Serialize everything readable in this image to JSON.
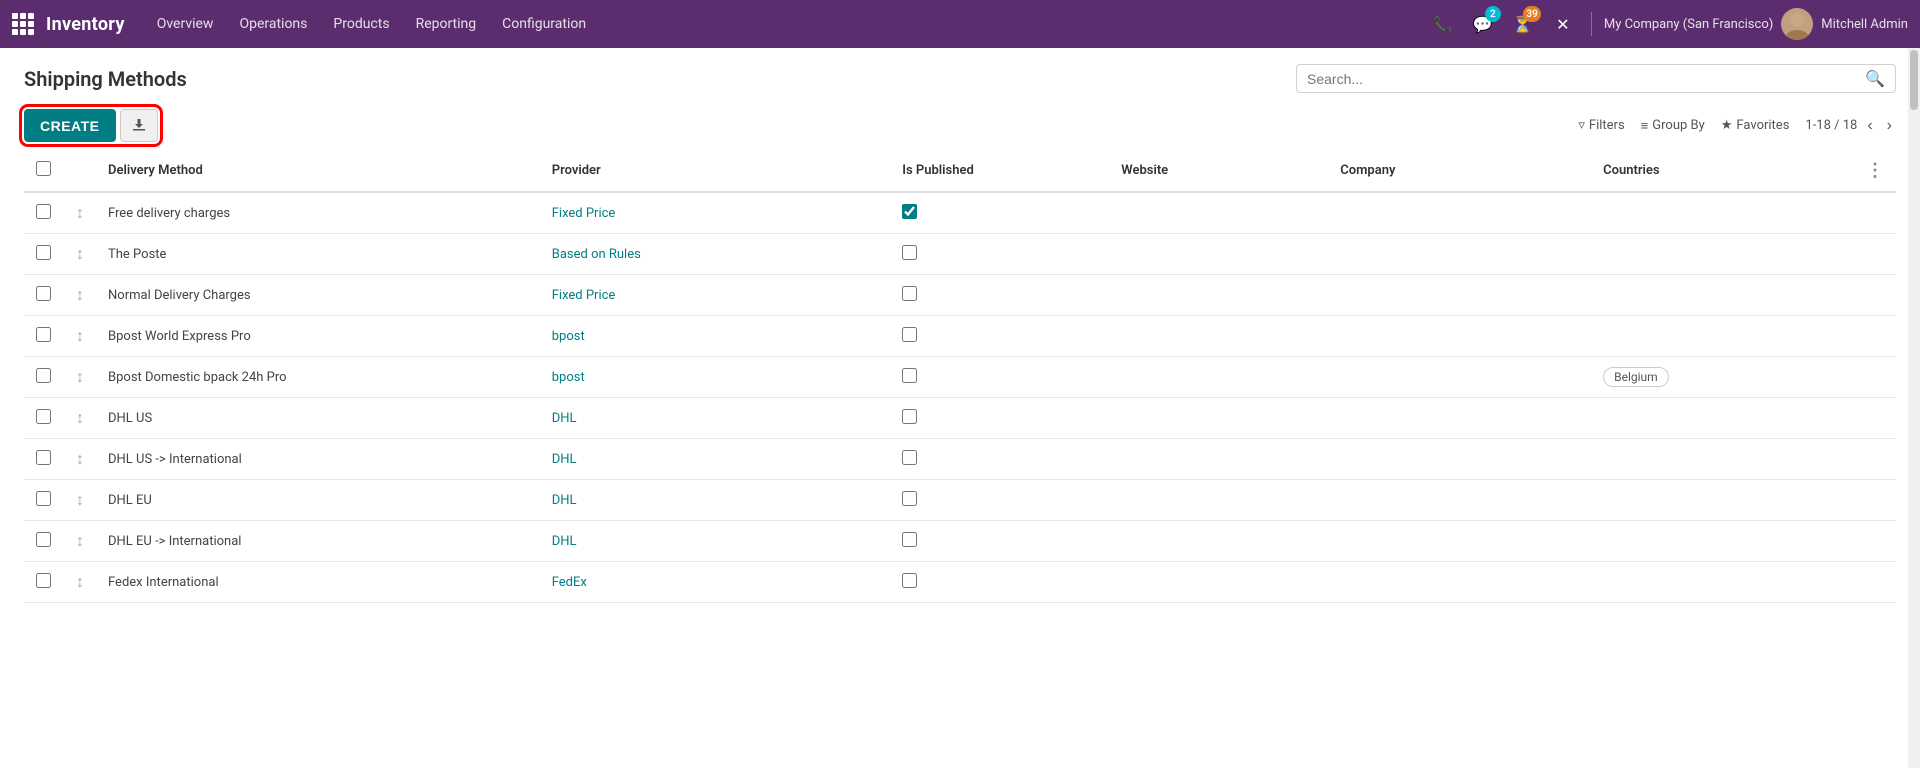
{
  "topnav": {
    "brand": "Inventory",
    "menu_items": [
      "Overview",
      "Operations",
      "Products",
      "Reporting",
      "Configuration"
    ],
    "badge_messages": "2",
    "badge_activity": "39",
    "company": "My Company (San Francisco)",
    "username": "Mitchell Admin"
  },
  "page": {
    "title": "Shipping Methods",
    "search_placeholder": "Search...",
    "create_label": "CREATE",
    "filters_label": "Filters",
    "group_by_label": "Group By",
    "favorites_label": "Favorites",
    "pagination": "1-18 / 18"
  },
  "table": {
    "columns": [
      "Delivery Method",
      "Provider",
      "Is Published",
      "Website",
      "Company",
      "Countries"
    ],
    "rows": [
      {
        "name": "Free delivery charges",
        "provider": "Fixed Price",
        "is_published": true,
        "website": "",
        "company": "",
        "countries": ""
      },
      {
        "name": "The Poste",
        "provider": "Based on Rules",
        "is_published": false,
        "website": "",
        "company": "",
        "countries": ""
      },
      {
        "name": "Normal Delivery Charges",
        "provider": "Fixed Price",
        "is_published": false,
        "website": "",
        "company": "",
        "countries": ""
      },
      {
        "name": "Bpost World Express Pro",
        "provider": "bpost",
        "is_published": false,
        "website": "",
        "company": "",
        "countries": ""
      },
      {
        "name": "Bpost Domestic bpack 24h Pro",
        "provider": "bpost",
        "is_published": false,
        "website": "",
        "company": "",
        "countries": "Belgium"
      },
      {
        "name": "DHL US",
        "provider": "DHL",
        "is_published": false,
        "website": "",
        "company": "",
        "countries": ""
      },
      {
        "name": "DHL US -> International",
        "provider": "DHL",
        "is_published": false,
        "website": "",
        "company": "",
        "countries": ""
      },
      {
        "name": "DHL EU",
        "provider": "DHL",
        "is_published": false,
        "website": "",
        "company": "",
        "countries": ""
      },
      {
        "name": "DHL EU -> International",
        "provider": "DHL",
        "is_published": false,
        "website": "",
        "company": "",
        "countries": ""
      },
      {
        "name": "Fedex International",
        "provider": "FedEx",
        "is_published": false,
        "website": "",
        "company": "",
        "countries": ""
      }
    ]
  }
}
